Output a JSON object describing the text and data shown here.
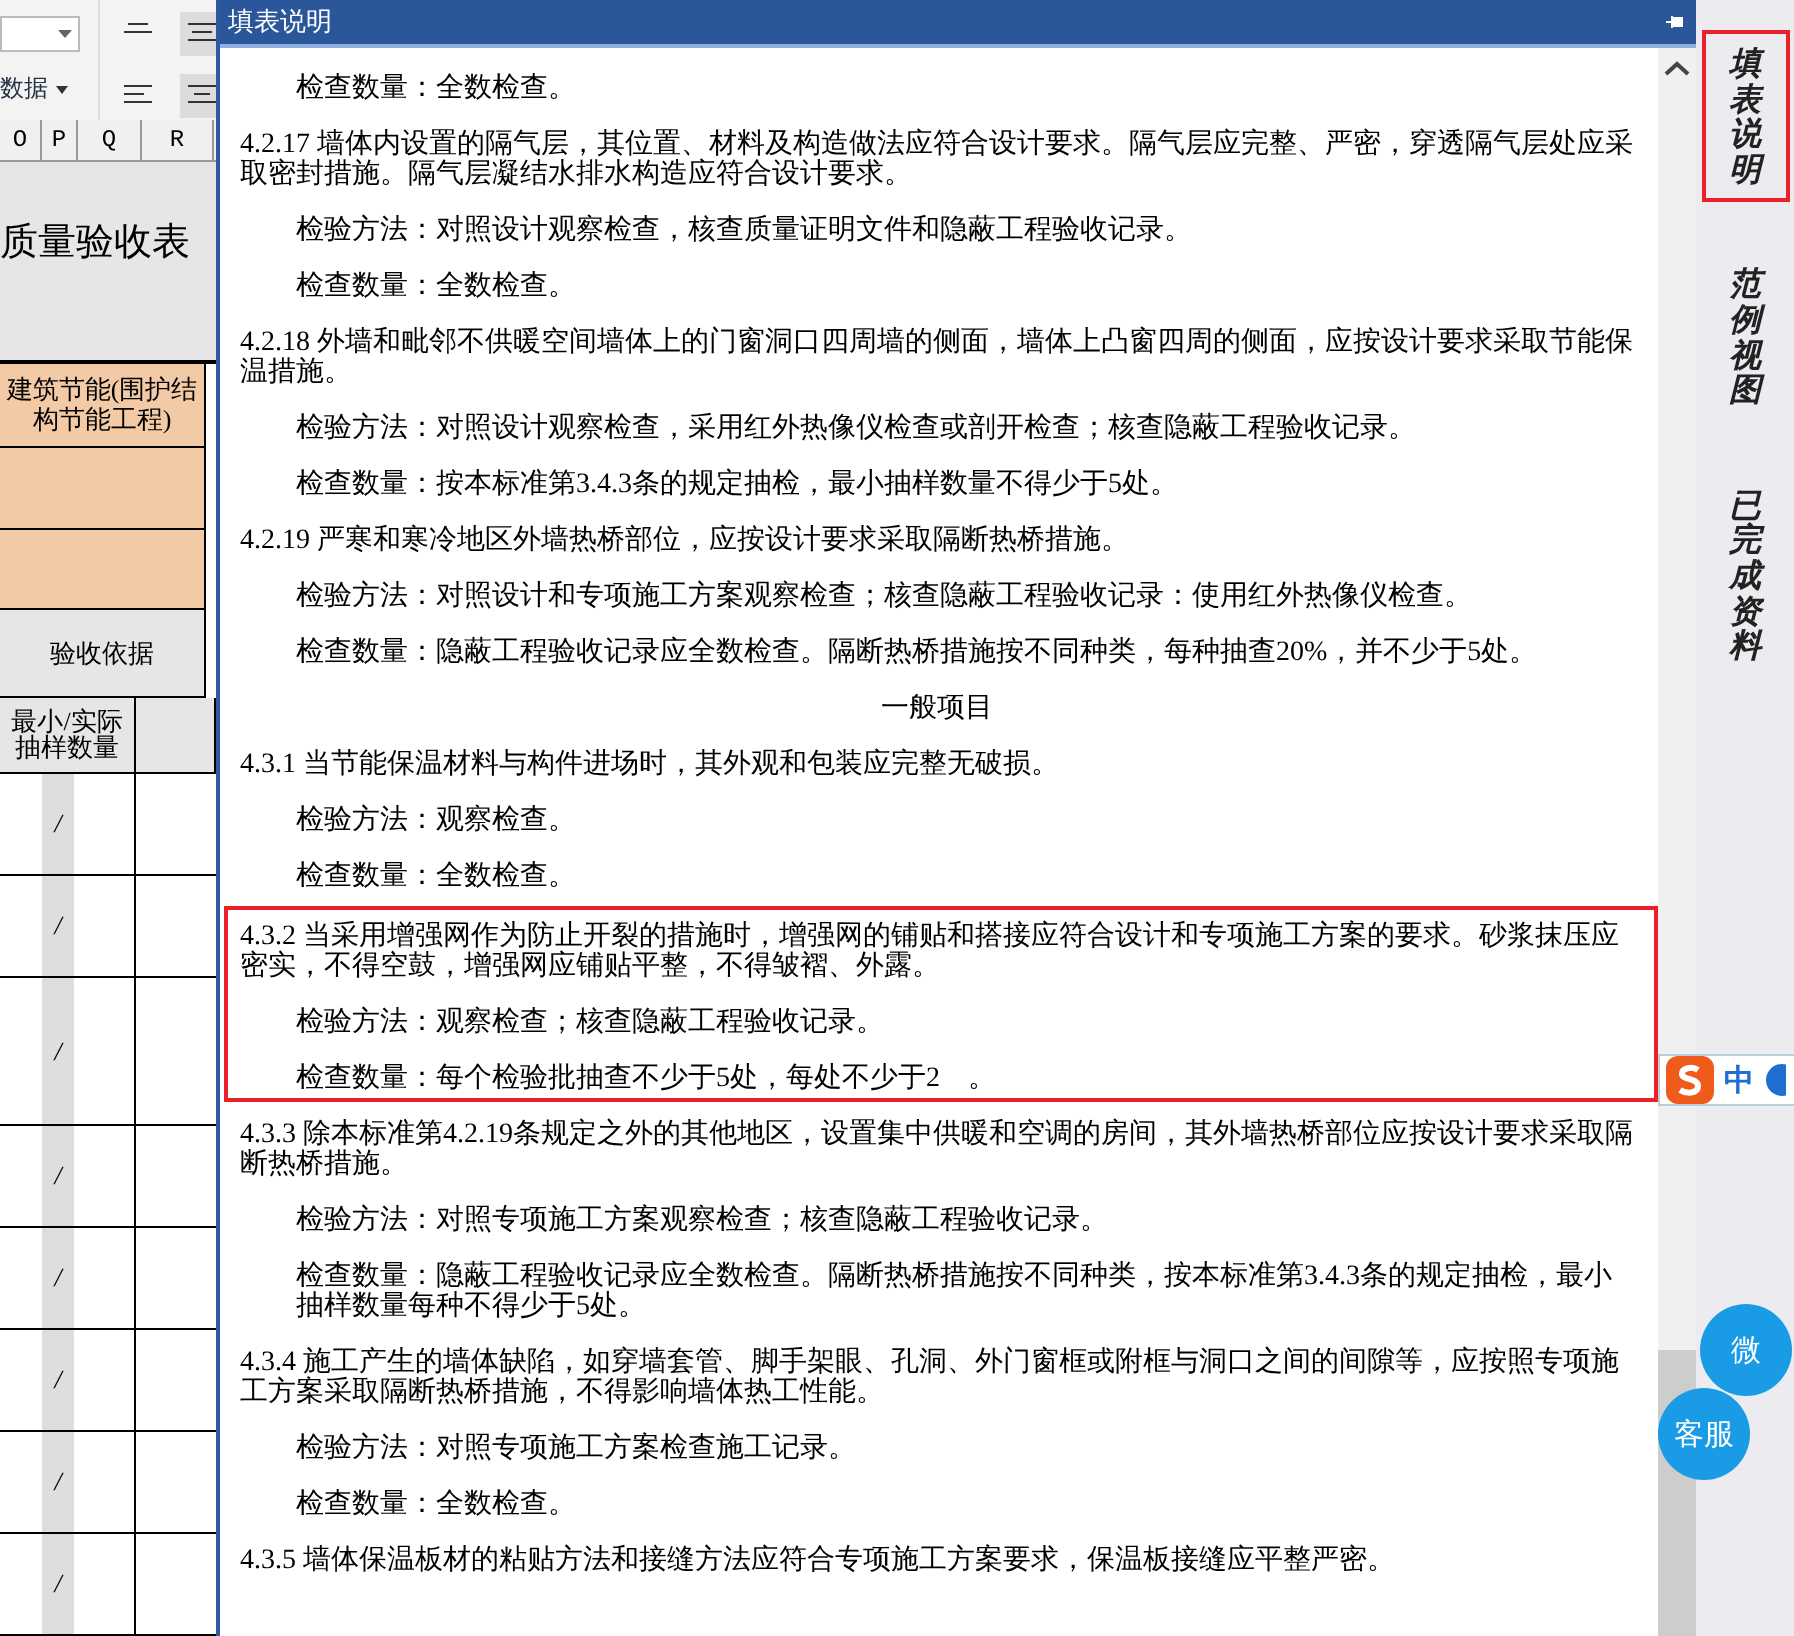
{
  "sheet": {
    "toolbar_dropdown_text": "数据",
    "columns": [
      "O",
      "P",
      "Q",
      "R"
    ],
    "title": "质量验收表",
    "category": "建筑节能(围护结构节能工程)",
    "basis_label": "验收依据",
    "sample_header": "最小/实际抽样数量",
    "rows": [
      {
        "value": "/"
      },
      {
        "value": "/"
      },
      {
        "value": "/"
      },
      {
        "value": "/"
      },
      {
        "value": "/"
      },
      {
        "value": "/"
      },
      {
        "value": "/"
      },
      {
        "value": "/"
      }
    ]
  },
  "panel": {
    "title": "填表说明",
    "blocks": [
      {
        "highlighted": false,
        "paragraphs": [
          {
            "kind": "detail",
            "text": "检查数量：全数检查。"
          },
          {
            "kind": "clause",
            "text": "4.2.17 墙体内设置的隔气层，其位置、材料及构造做法应符合设计要求。隔气层应完整、严密，穿透隔气层处应采取密封措施。隔气层凝结水排水构造应符合设计要求。"
          },
          {
            "kind": "detail",
            "text": "检验方法：对照设计观察检查，核查质量证明文件和隐蔽工程验收记录。"
          },
          {
            "kind": "detail",
            "text": "检查数量：全数检查。"
          },
          {
            "kind": "clause",
            "text": "4.2.18 外墙和毗邻不供暖空间墙体上的门窗洞口四周墙的侧面，墙体上凸窗四周的侧面，应按设计要求采取节能保温措施。"
          },
          {
            "kind": "detail",
            "text": "检验方法：对照设计观察检查，采用红外热像仪检查或剖开检查；核查隐蔽工程验收记录。"
          },
          {
            "kind": "detail",
            "text": "检查数量：按本标准第3.4.3条的规定抽检，最小抽样数量不得少于5处。"
          },
          {
            "kind": "clause",
            "text": "4.2.19 严寒和寒冷地区外墙热桥部位，应按设计要求采取隔断热桥措施。"
          },
          {
            "kind": "detail",
            "text": "检验方法：对照设计和专项施工方案观察检查；核查隐蔽工程验收记录：使用红外热像仪检查。"
          },
          {
            "kind": "detail",
            "text": "检查数量：隐蔽工程验收记录应全数检查。隔断热桥措施按不同种类，每种抽查20%，并不少于5处。"
          },
          {
            "kind": "heading",
            "text": "一般项目"
          },
          {
            "kind": "clause",
            "text": "4.3.1 当节能保温材料与构件进场时，其外观和包装应完整无破损。"
          },
          {
            "kind": "detail",
            "text": "检验方法：观察检查。"
          },
          {
            "kind": "detail",
            "text": "检查数量：全数检查。"
          }
        ]
      },
      {
        "highlighted": true,
        "paragraphs": [
          {
            "kind": "clause",
            "text": "4.3.2 当采用增强网作为防止开裂的措施时，增强网的铺贴和搭接应符合设计和专项施工方案的要求。砂浆抹压应密实，不得空鼓，增强网应铺贴平整，不得皱褶、外露。"
          },
          {
            "kind": "detail",
            "text": "检验方法：观察检查；核查隐蔽工程验收记录。"
          },
          {
            "kind": "detail",
            "text": "检查数量：每个检验批抽查不少于5处，每处不少于2　。"
          }
        ]
      },
      {
        "highlighted": false,
        "paragraphs": [
          {
            "kind": "clause",
            "text": "4.3.3 除本标准第4.2.19条规定之外的其他地区，设置集中供暖和空调的房间，其外墙热桥部位应按设计要求采取隔断热桥措施。"
          },
          {
            "kind": "detail",
            "text": "检验方法：对照专项施工方案观察检查；核查隐蔽工程验收记录。"
          },
          {
            "kind": "detail",
            "text": "检查数量：隐蔽工程验收记录应全数检查。隔断热桥措施按不同种类，按本标准第3.4.3条的规定抽检，最小抽样数量每种不得少于5处。"
          },
          {
            "kind": "clause",
            "text": "4.3.4 施工产生的墙体缺陷，如穿墙套管、脚手架眼、孔洞、外门窗框或附框与洞口之间的间隙等，应按照专项施工方案采取隔断热桥措施，不得影响墙体热工性能。"
          },
          {
            "kind": "detail",
            "text": "检验方法：对照专项施工方案检查施工记录。"
          },
          {
            "kind": "detail",
            "text": "检查数量：全数检查。"
          },
          {
            "kind": "clause",
            "text": "4.3.5 墙体保温板材的粘贴方法和接缝方法应符合专项施工方案要求，保温板接缝应平整严密。"
          }
        ]
      }
    ]
  },
  "side_tabs": [
    {
      "label": "填表说明",
      "selected": true
    },
    {
      "label": "范例视图",
      "selected": false
    },
    {
      "label": "已完成资料",
      "selected": false
    }
  ],
  "ime_bar": {
    "mode": "中"
  },
  "float_buttons": [
    {
      "label": "微"
    },
    {
      "label": "客服"
    }
  ]
}
